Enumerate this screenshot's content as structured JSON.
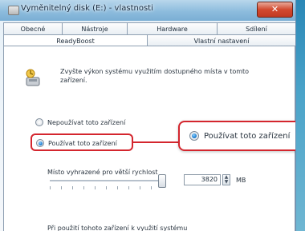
{
  "window": {
    "title": "Vyměnitelný disk (E:) - vlastnosti",
    "close_symbol": "✕"
  },
  "tabs": {
    "row1": [
      "Obecné",
      "Nástroje",
      "Hardware",
      "Sdílení"
    ],
    "row2": [
      "ReadyBoost",
      "Vlastní nastavení"
    ],
    "active": "ReadyBoost"
  },
  "readyboost": {
    "icon": "readyboost-icon",
    "description": "Zvyšte výkon systému využitím dostupného místa v tomto zařízení.",
    "option_off": "Nepoužívat toto zařízení",
    "option_on": "Používat toto zařízení",
    "selected": "option_on",
    "space_label": "Místo vyhrazené pro větší rychlost",
    "space_value": "3820",
    "space_unit": "MB",
    "slider_level": 0.97,
    "bottom_text": "Při použití tohoto zařízení k využití systému"
  },
  "callout": {
    "label": "Používat toto zařízení",
    "color": "#d4262e"
  }
}
